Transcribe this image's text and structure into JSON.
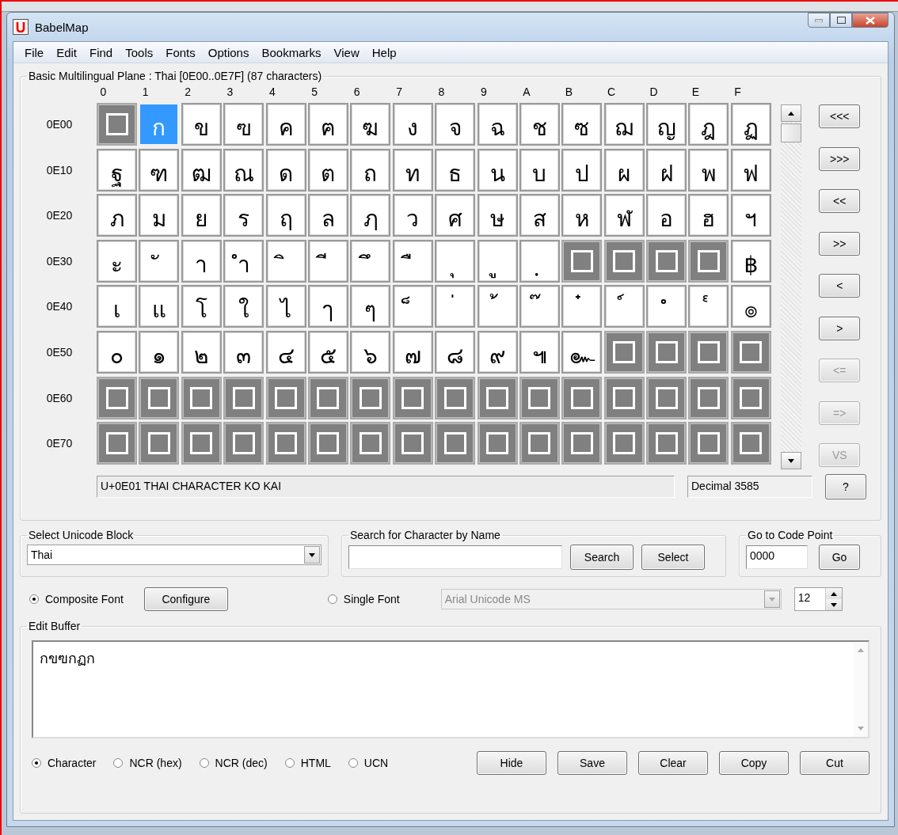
{
  "window": {
    "title": "BabelMap"
  },
  "menu": [
    "File",
    "Edit",
    "Find",
    "Tools",
    "Fonts",
    "Options",
    "Bookmarks",
    "View",
    "Help"
  ],
  "grid": {
    "title": "Basic Multilingual Plane : Thai [0E00..0E7F] (87 characters)",
    "columns": [
      "0",
      "1",
      "2",
      "3",
      "4",
      "5",
      "6",
      "7",
      "8",
      "9",
      "A",
      "B",
      "C",
      "D",
      "E",
      "F"
    ],
    "rows": [
      {
        "label": "0E00",
        "cells": [
          {
            "kind": "unassigned",
            "selected": false
          },
          {
            "kind": "char",
            "text": "ก",
            "selected": true
          },
          {
            "kind": "char",
            "text": "ข",
            "selected": false
          },
          {
            "kind": "char",
            "text": "ฃ",
            "selected": false
          },
          {
            "kind": "char",
            "text": "ค",
            "selected": false
          },
          {
            "kind": "char",
            "text": "ฅ",
            "selected": false
          },
          {
            "kind": "char",
            "text": "ฆ",
            "selected": false
          },
          {
            "kind": "char",
            "text": "ง",
            "selected": false
          },
          {
            "kind": "char",
            "text": "จ",
            "selected": false
          },
          {
            "kind": "char",
            "text": "ฉ",
            "selected": false
          },
          {
            "kind": "char",
            "text": "ช",
            "selected": false
          },
          {
            "kind": "char",
            "text": "ซ",
            "selected": false
          },
          {
            "kind": "char",
            "text": "ฌ",
            "selected": false
          },
          {
            "kind": "char",
            "text": "ญ",
            "selected": false
          },
          {
            "kind": "char",
            "text": "ฎ",
            "selected": false
          },
          {
            "kind": "char",
            "text": "ฏ",
            "selected": false
          }
        ]
      },
      {
        "label": "0E10",
        "cells": [
          {
            "kind": "char",
            "text": "ฐ",
            "selected": false
          },
          {
            "kind": "char",
            "text": "ฑ",
            "selected": false
          },
          {
            "kind": "char",
            "text": "ฒ",
            "selected": false
          },
          {
            "kind": "char",
            "text": "ณ",
            "selected": false
          },
          {
            "kind": "char",
            "text": "ด",
            "selected": false
          },
          {
            "kind": "char",
            "text": "ต",
            "selected": false
          },
          {
            "kind": "char",
            "text": "ถ",
            "selected": false
          },
          {
            "kind": "char",
            "text": "ท",
            "selected": false
          },
          {
            "kind": "char",
            "text": "ธ",
            "selected": false
          },
          {
            "kind": "char",
            "text": "น",
            "selected": false
          },
          {
            "kind": "char",
            "text": "บ",
            "selected": false
          },
          {
            "kind": "char",
            "text": "ป",
            "selected": false
          },
          {
            "kind": "char",
            "text": "ผ",
            "selected": false
          },
          {
            "kind": "char",
            "text": "ฝ",
            "selected": false
          },
          {
            "kind": "char",
            "text": "พ",
            "selected": false
          },
          {
            "kind": "char",
            "text": "ฟ",
            "selected": false
          }
        ]
      },
      {
        "label": "0E20",
        "cells": [
          {
            "kind": "char",
            "text": "ภ",
            "selected": false
          },
          {
            "kind": "char",
            "text": "ม",
            "selected": false
          },
          {
            "kind": "char",
            "text": "ย",
            "selected": false
          },
          {
            "kind": "char",
            "text": "ร",
            "selected": false
          },
          {
            "kind": "char",
            "text": "ฤ",
            "selected": false
          },
          {
            "kind": "char",
            "text": "ล",
            "selected": false
          },
          {
            "kind": "char",
            "text": "ฦ",
            "selected": false
          },
          {
            "kind": "char",
            "text": "ว",
            "selected": false
          },
          {
            "kind": "char",
            "text": "ศ",
            "selected": false
          },
          {
            "kind": "char",
            "text": "ษ",
            "selected": false
          },
          {
            "kind": "char",
            "text": "ส",
            "selected": false
          },
          {
            "kind": "char",
            "text": "ห",
            "selected": false
          },
          {
            "kind": "char",
            "text": "ฬ",
            "selected": false
          },
          {
            "kind": "char",
            "text": "อ",
            "selected": false
          },
          {
            "kind": "char",
            "text": "ฮ",
            "selected": false
          },
          {
            "kind": "char",
            "text": "ฯ",
            "selected": false
          }
        ]
      },
      {
        "label": "0E30",
        "cells": [
          {
            "kind": "char",
            "text": "ะ",
            "selected": false
          },
          {
            "kind": "char",
            "text": "ั",
            "selected": false
          },
          {
            "kind": "char",
            "text": "า",
            "selected": false
          },
          {
            "kind": "char",
            "text": "ำ",
            "selected": false
          },
          {
            "kind": "char",
            "text": "ิ",
            "selected": false
          },
          {
            "kind": "char",
            "text": "ี",
            "selected": false
          },
          {
            "kind": "char",
            "text": "ึ",
            "selected": false
          },
          {
            "kind": "char",
            "text": "ื",
            "selected": false
          },
          {
            "kind": "char",
            "text": "ุ",
            "selected": false
          },
          {
            "kind": "char",
            "text": "ู",
            "selected": false
          },
          {
            "kind": "char",
            "text": "ฺ",
            "selected": false
          },
          {
            "kind": "unassigned",
            "selected": false
          },
          {
            "kind": "unassigned",
            "selected": false
          },
          {
            "kind": "unassigned",
            "selected": false
          },
          {
            "kind": "unassigned",
            "selected": false
          },
          {
            "kind": "char",
            "text": "฿",
            "selected": false
          }
        ]
      },
      {
        "label": "0E40",
        "cells": [
          {
            "kind": "char",
            "text": "เ",
            "selected": false
          },
          {
            "kind": "char",
            "text": "แ",
            "selected": false
          },
          {
            "kind": "char",
            "text": "โ",
            "selected": false
          },
          {
            "kind": "char",
            "text": "ใ",
            "selected": false
          },
          {
            "kind": "char",
            "text": "ไ",
            "selected": false
          },
          {
            "kind": "char",
            "text": "ๅ",
            "selected": false
          },
          {
            "kind": "char",
            "text": "ๆ",
            "selected": false
          },
          {
            "kind": "char",
            "text": "็",
            "selected": false
          },
          {
            "kind": "char",
            "text": "่",
            "selected": false
          },
          {
            "kind": "char",
            "text": "้",
            "selected": false
          },
          {
            "kind": "char",
            "text": "๊",
            "selected": false
          },
          {
            "kind": "char",
            "text": "๋",
            "selected": false
          },
          {
            "kind": "char",
            "text": "์",
            "selected": false
          },
          {
            "kind": "char",
            "text": "ํ",
            "selected": false
          },
          {
            "kind": "char",
            "text": "๎",
            "selected": false
          },
          {
            "kind": "char",
            "text": "๏",
            "selected": false
          }
        ]
      },
      {
        "label": "0E50",
        "cells": [
          {
            "kind": "char",
            "text": "๐",
            "selected": false
          },
          {
            "kind": "char",
            "text": "๑",
            "selected": false
          },
          {
            "kind": "char",
            "text": "๒",
            "selected": false
          },
          {
            "kind": "char",
            "text": "๓",
            "selected": false
          },
          {
            "kind": "char",
            "text": "๔",
            "selected": false
          },
          {
            "kind": "char",
            "text": "๕",
            "selected": false
          },
          {
            "kind": "char",
            "text": "๖",
            "selected": false
          },
          {
            "kind": "char",
            "text": "๗",
            "selected": false
          },
          {
            "kind": "char",
            "text": "๘",
            "selected": false
          },
          {
            "kind": "char",
            "text": "๙",
            "selected": false
          },
          {
            "kind": "char",
            "text": "๚",
            "selected": false
          },
          {
            "kind": "char",
            "text": "๛",
            "selected": false
          },
          {
            "kind": "unassigned",
            "selected": false
          },
          {
            "kind": "unassigned",
            "selected": false
          },
          {
            "kind": "unassigned",
            "selected": false
          },
          {
            "kind": "unassigned",
            "selected": false
          }
        ]
      },
      {
        "label": "0E60",
        "cells": [
          {
            "kind": "unassigned",
            "selected": false
          },
          {
            "kind": "unassigned",
            "selected": false
          },
          {
            "kind": "unassigned",
            "selected": false
          },
          {
            "kind": "unassigned",
            "selected": false
          },
          {
            "kind": "unassigned",
            "selected": false
          },
          {
            "kind": "unassigned",
            "selected": false
          },
          {
            "kind": "unassigned",
            "selected": false
          },
          {
            "kind": "unassigned",
            "selected": false
          },
          {
            "kind": "unassigned",
            "selected": false
          },
          {
            "kind": "unassigned",
            "selected": false
          },
          {
            "kind": "unassigned",
            "selected": false
          },
          {
            "kind": "unassigned",
            "selected": false
          },
          {
            "kind": "unassigned",
            "selected": false
          },
          {
            "kind": "unassigned",
            "selected": false
          },
          {
            "kind": "unassigned",
            "selected": false
          },
          {
            "kind": "unassigned",
            "selected": false
          }
        ]
      },
      {
        "label": "0E70",
        "cells": [
          {
            "kind": "unassigned",
            "selected": false
          },
          {
            "kind": "unassigned",
            "selected": false
          },
          {
            "kind": "unassigned",
            "selected": false
          },
          {
            "kind": "unassigned",
            "selected": false
          },
          {
            "kind": "unassigned",
            "selected": false
          },
          {
            "kind": "unassigned",
            "selected": false
          },
          {
            "kind": "unassigned",
            "selected": false
          },
          {
            "kind": "unassigned",
            "selected": false
          },
          {
            "kind": "unassigned",
            "selected": false
          },
          {
            "kind": "unassigned",
            "selected": false
          },
          {
            "kind": "unassigned",
            "selected": false
          },
          {
            "kind": "unassigned",
            "selected": false
          },
          {
            "kind": "unassigned",
            "selected": false
          },
          {
            "kind": "unassigned",
            "selected": false
          },
          {
            "kind": "unassigned",
            "selected": false
          },
          {
            "kind": "unassigned",
            "selected": false
          }
        ]
      }
    ],
    "status": "U+0E01 THAI CHARACTER KO KAI",
    "decimal": "Decimal 3585",
    "help_button": "?"
  },
  "nav_buttons": [
    {
      "label": "<<<",
      "disabled": false
    },
    {
      "label": ">>>",
      "disabled": false
    },
    {
      "label": "<<",
      "disabled": false
    },
    {
      "label": ">>",
      "disabled": false
    },
    {
      "label": "<",
      "disabled": false
    },
    {
      "label": ">",
      "disabled": false
    },
    {
      "label": "<=",
      "disabled": true
    },
    {
      "label": "=>",
      "disabled": true
    },
    {
      "label": "VS",
      "disabled": true
    }
  ],
  "unicode_block": {
    "title": "Select Unicode Block",
    "value": "Thai"
  },
  "name_search": {
    "title": "Search for Character by Name",
    "buttons": [
      "Search",
      "Select"
    ]
  },
  "goto": {
    "title": "Go to Code Point",
    "value": "0000",
    "button": "Go"
  },
  "font_options": [
    {
      "label": "Composite Font",
      "selected": true
    },
    {
      "label": "Single Font",
      "selected": false
    }
  ],
  "configure_button": "Configure",
  "single_font": {
    "value": "Arial Unicode MS",
    "disabled": true
  },
  "font_size": "12",
  "edit_buffer": {
    "title": "Edit Buffer",
    "text": "กขฃกฏก",
    "formats": [
      {
        "label": "Character",
        "selected": true
      },
      {
        "label": "NCR (hex)",
        "selected": false
      },
      {
        "label": "NCR (dec)",
        "selected": false
      },
      {
        "label": "HTML",
        "selected": false
      },
      {
        "label": "UCN",
        "selected": false
      }
    ],
    "buttons": [
      "Hide",
      "Save",
      "Clear",
      "Copy",
      "Cut"
    ]
  }
}
